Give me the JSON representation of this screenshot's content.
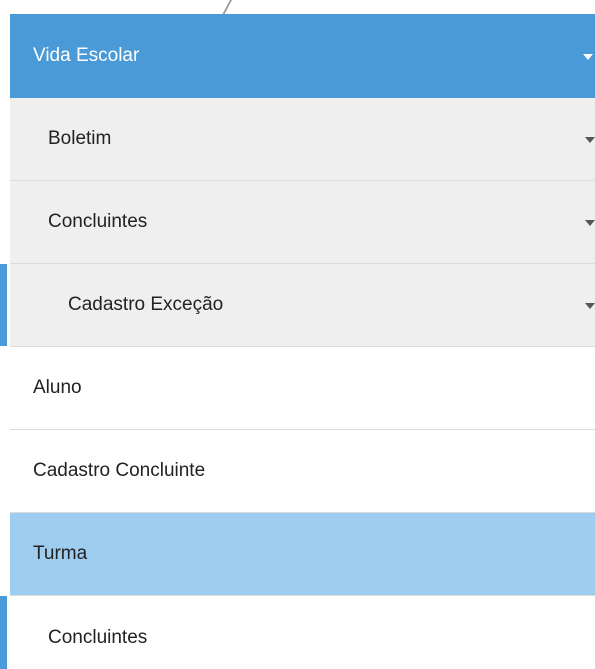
{
  "menu": {
    "header": {
      "label": "Vida Escolar",
      "icon": "chevron-down-icon"
    },
    "items": [
      {
        "label": "Boletim"
      },
      {
        "label": "Concluintes"
      },
      {
        "label": "Cadastro Exceção"
      },
      {
        "label": "Aluno"
      },
      {
        "label": "Cadastro Concluinte"
      },
      {
        "label": "Turma"
      },
      {
        "label": "Concluintes"
      }
    ]
  },
  "colors": {
    "accent": "#4a9ad7",
    "selected": "#9ecdf0",
    "submenu_bg": "#efefef"
  }
}
